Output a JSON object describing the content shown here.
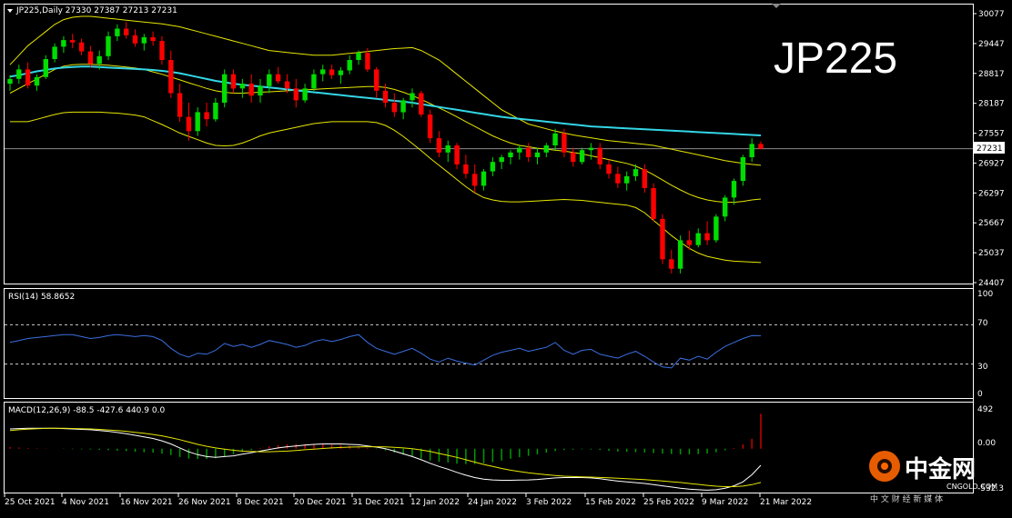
{
  "colors": {
    "background": "#000000",
    "frame": "#ffffff",
    "bull": "#00dd00",
    "bear": "#ff0000",
    "ma200": "#33d6e6",
    "bollinger": "#e6e600",
    "rsi": "#3a6fe0",
    "macd_line": "#ffffff",
    "macd_signal": "#e6e600",
    "hist_pos": "#cc0000",
    "hist_neg": "#009900",
    "watermark": "#ff6600"
  },
  "header": {
    "menu_icon": "triangle-down-icon",
    "text": "JP225,Daily  27330 27387 27213 27231"
  },
  "overlay_title": "JP225",
  "price_axis": {
    "labels": [
      "30077",
      "29447",
      "28817",
      "28187",
      "27557",
      "26927",
      "26297",
      "25667",
      "25037",
      "24407"
    ],
    "values": [
      30077,
      29447,
      28817,
      28187,
      27557,
      26927,
      26297,
      25667,
      25037,
      24407
    ],
    "current": "27231",
    "current_value": 27231
  },
  "rsi": {
    "title": "RSI(14) 58.8652",
    "axis_labels": [
      "100",
      "70",
      "30",
      "0"
    ],
    "levels": [
      70,
      30
    ]
  },
  "macd": {
    "title": "MACD(12,26,9) -88.5 -427.6 440.9 0.0",
    "axis_labels": [
      "492",
      "0.00",
      "-532.3"
    ]
  },
  "date_labels": [
    "25 Oct 2021",
    "4 Nov 2021",
    "16 Nov 2021",
    "26 Nov 2021",
    "8 Dec 2021",
    "20 Dec 2021",
    "31 Dec 2021",
    "12 Jan 2022",
    "24 Jan 2022",
    "3 Feb 2022",
    "15 Feb 2022",
    "25 Feb 2022",
    "9 Mar 2022",
    "21 Mar 2022"
  ],
  "watermark": {
    "logo_icon": "zhongjin-logo-icon",
    "name": "中金网",
    "domain": "CNGOLD.COM",
    "slogan": "中 文 财 经 新 媒 体"
  },
  "chart_data": {
    "type": "candlestick",
    "symbol": "JP225",
    "timeframe": "Daily",
    "ohlc_last": {
      "open": 27330,
      "high": 27387,
      "low": 27213,
      "close": 27231
    },
    "ylim": [
      24407,
      30077
    ],
    "candles": [
      [
        28600,
        28780,
        28450,
        28700
      ],
      [
        28700,
        29000,
        28600,
        28900
      ],
      [
        28900,
        29050,
        28500,
        28560
      ],
      [
        28560,
        28800,
        28450,
        28740
      ],
      [
        28740,
        29200,
        28700,
        29120
      ],
      [
        29120,
        29450,
        29050,
        29380
      ],
      [
        29380,
        29600,
        29250,
        29520
      ],
      [
        29520,
        29650,
        29350,
        29470
      ],
      [
        29470,
        29550,
        29200,
        29280
      ],
      [
        29280,
        29400,
        28950,
        29020
      ],
      [
        29020,
        29300,
        28900,
        29180
      ],
      [
        29180,
        29700,
        29100,
        29600
      ],
      [
        29600,
        29850,
        29500,
        29760
      ],
      [
        29760,
        29900,
        29550,
        29620
      ],
      [
        29620,
        29750,
        29380,
        29450
      ],
      [
        29450,
        29650,
        29300,
        29580
      ],
      [
        29580,
        29700,
        29400,
        29500
      ],
      [
        29500,
        29600,
        29000,
        29100
      ],
      [
        29100,
        29300,
        28300,
        28400
      ],
      [
        28400,
        28600,
        27800,
        27900
      ],
      [
        27900,
        28200,
        27400,
        27600
      ],
      [
        27600,
        28100,
        27500,
        28000
      ],
      [
        28000,
        28200,
        27700,
        27850
      ],
      [
        27850,
        28300,
        27800,
        28200
      ],
      [
        28200,
        28900,
        28100,
        28800
      ],
      [
        28800,
        28900,
        28400,
        28500
      ],
      [
        28500,
        28700,
        28300,
        28600
      ],
      [
        28600,
        28800,
        28200,
        28350
      ],
      [
        28350,
        28700,
        28200,
        28550
      ],
      [
        28550,
        28900,
        28400,
        28800
      ],
      [
        28800,
        28950,
        28600,
        28650
      ],
      [
        28650,
        28800,
        28400,
        28500
      ],
      [
        28500,
        28700,
        28100,
        28250
      ],
      [
        28250,
        28600,
        28200,
        28500
      ],
      [
        28500,
        28900,
        28450,
        28800
      ],
      [
        28800,
        29000,
        28650,
        28900
      ],
      [
        28900,
        29000,
        28700,
        28780
      ],
      [
        28780,
        28950,
        28600,
        28880
      ],
      [
        28880,
        29200,
        28800,
        29100
      ],
      [
        29100,
        29300,
        29000,
        29250
      ],
      [
        29250,
        29350,
        28850,
        28900
      ],
      [
        28900,
        28950,
        28300,
        28450
      ],
      [
        28450,
        28600,
        28100,
        28200
      ],
      [
        28200,
        28400,
        27900,
        28000
      ],
      [
        28000,
        28300,
        27850,
        28250
      ],
      [
        28250,
        28500,
        28100,
        28400
      ],
      [
        28400,
        28450,
        27900,
        27950
      ],
      [
        27950,
        28050,
        27350,
        27450
      ],
      [
        27450,
        27600,
        27050,
        27150
      ],
      [
        27150,
        27400,
        26950,
        27300
      ],
      [
        27300,
        27350,
        26800,
        26900
      ],
      [
        26900,
        27100,
        26600,
        26700
      ],
      [
        26700,
        26900,
        26300,
        26450
      ],
      [
        26450,
        26800,
        26350,
        26750
      ],
      [
        26750,
        27050,
        26650,
        26950
      ],
      [
        26950,
        27100,
        26800,
        27050
      ],
      [
        27050,
        27200,
        26900,
        27150
      ],
      [
        27150,
        27300,
        27000,
        27250
      ],
      [
        27250,
        27350,
        26950,
        27050
      ],
      [
        27050,
        27250,
        26900,
        27150
      ],
      [
        27150,
        27350,
        27050,
        27300
      ],
      [
        27300,
        27650,
        27200,
        27550
      ],
      [
        27550,
        27650,
        27050,
        27150
      ],
      [
        27150,
        27250,
        26850,
        26950
      ],
      [
        26950,
        27250,
        26900,
        27200
      ],
      [
        27200,
        27350,
        27000,
        27250
      ],
      [
        27250,
        27350,
        26800,
        26900
      ],
      [
        26900,
        27000,
        26600,
        26700
      ],
      [
        26700,
        26850,
        26400,
        26500
      ],
      [
        26500,
        26750,
        26350,
        26650
      ],
      [
        26650,
        26900,
        26550,
        26800
      ],
      [
        26800,
        26900,
        26300,
        26400
      ],
      [
        26400,
        26500,
        25700,
        25750
      ],
      [
        25750,
        25850,
        24800,
        24900
      ],
      [
        24900,
        25100,
        24600,
        24700
      ],
      [
        24700,
        25400,
        24600,
        25300
      ],
      [
        25300,
        25500,
        25100,
        25200
      ],
      [
        25200,
        25550,
        25150,
        25450
      ],
      [
        25450,
        25700,
        25200,
        25300
      ],
      [
        25300,
        25850,
        25250,
        25800
      ],
      [
        25800,
        26250,
        25700,
        26200
      ],
      [
        26200,
        26600,
        26050,
        26550
      ],
      [
        26550,
        27100,
        26450,
        27050
      ],
      [
        27050,
        27450,
        26950,
        27330
      ],
      [
        27330,
        27387,
        27213,
        27231
      ]
    ],
    "moving_average_200": [
      28750,
      28780,
      28820,
      28860,
      28890,
      28920,
      28940,
      28950,
      28960,
      28960,
      28950,
      28940,
      28930,
      28920,
      28910,
      28900,
      28890,
      28870,
      28850,
      28820,
      28780,
      28740,
      28700,
      28660,
      28630,
      28600,
      28580,
      28560,
      28540,
      28520,
      28500,
      28480,
      28460,
      28440,
      28420,
      28400,
      28380,
      28360,
      28340,
      28320,
      28300,
      28280,
      28260,
      28240,
      28220,
      28200,
      28170,
      28140,
      28110,
      28080,
      28050,
      28020,
      27990,
      27960,
      27930,
      27900,
      27880,
      27860,
      27840,
      27820,
      27800,
      27780,
      27760,
      27740,
      27720,
      27700,
      27690,
      27680,
      27670,
      27660,
      27650,
      27640,
      27630,
      27620,
      27610,
      27600,
      27590,
      27580,
      27570,
      27560,
      27550,
      27540,
      27530,
      27520,
      27510
    ],
    "bollinger_upper": [
      29000,
      29200,
      29400,
      29550,
      29700,
      29850,
      29950,
      30000,
      30020,
      30020,
      30000,
      29980,
      29960,
      29940,
      29920,
      29900,
      29880,
      29860,
      29830,
      29800,
      29750,
      29700,
      29650,
      29600,
      29550,
      29500,
      29450,
      29400,
      29350,
      29300,
      29280,
      29260,
      29240,
      29220,
      29200,
      29200,
      29200,
      29220,
      29240,
      29260,
      29280,
      29300,
      29320,
      29340,
      29350,
      29360,
      29300,
      29200,
      29100,
      28950,
      28800,
      28650,
      28500,
      28350,
      28200,
      28050,
      27950,
      27850,
      27750,
      27700,
      27650,
      27600,
      27560,
      27520,
      27490,
      27460,
      27430,
      27400,
      27380,
      27360,
      27340,
      27320,
      27300,
      27260,
      27220,
      27180,
      27140,
      27100,
      27060,
      27020,
      26980,
      26950,
      26920,
      26900,
      26880
    ],
    "bollinger_middle": [
      28400,
      28500,
      28600,
      28700,
      28800,
      28900,
      28970,
      29000,
      29010,
      29010,
      29000,
      28990,
      28970,
      28950,
      28930,
      28900,
      28850,
      28800,
      28740,
      28680,
      28620,
      28560,
      28500,
      28450,
      28420,
      28400,
      28400,
      28410,
      28420,
      28430,
      28440,
      28450,
      28460,
      28470,
      28480,
      28490,
      28500,
      28510,
      28520,
      28530,
      28540,
      28540,
      28520,
      28480,
      28420,
      28350,
      28270,
      28180,
      28090,
      28000,
      27900,
      27800,
      27700,
      27600,
      27500,
      27420,
      27350,
      27300,
      27270,
      27240,
      27220,
      27200,
      27180,
      27150,
      27120,
      27080,
      27040,
      27000,
      26960,
      26920,
      26860,
      26780,
      26680,
      26570,
      26460,
      26360,
      26270,
      26200,
      26150,
      26120,
      26100,
      26100,
      26120,
      26150,
      26170
    ],
    "bollinger_lower": [
      27800,
      27800,
      27800,
      27850,
      27900,
      27950,
      27990,
      28000,
      28000,
      28000,
      28000,
      27990,
      27980,
      27960,
      27940,
      27900,
      27820,
      27740,
      27650,
      27560,
      27490,
      27420,
      27350,
      27300,
      27290,
      27300,
      27350,
      27420,
      27500,
      27560,
      27600,
      27640,
      27680,
      27720,
      27760,
      27780,
      27800,
      27800,
      27800,
      27800,
      27800,
      27780,
      27720,
      27620,
      27490,
      27340,
      27190,
      27030,
      26880,
      26730,
      26580,
      26430,
      26300,
      26200,
      26150,
      26120,
      26110,
      26110,
      26120,
      26130,
      26140,
      26150,
      26160,
      26150,
      26140,
      26120,
      26100,
      26080,
      26060,
      26040,
      25990,
      25880,
      25720,
      25560,
      25400,
      25260,
      25130,
      25030,
      24960,
      24920,
      24880,
      24860,
      24850,
      24840,
      24830
    ],
    "rsi_series": [
      52,
      54,
      56,
      57,
      58,
      59,
      60,
      60,
      58,
      56,
      57,
      59,
      60,
      59,
      58,
      59,
      58,
      54,
      46,
      40,
      37,
      41,
      40,
      44,
      51,
      48,
      50,
      47,
      50,
      54,
      52,
      50,
      47,
      49,
      53,
      55,
      53,
      55,
      58,
      60,
      52,
      46,
      43,
      40,
      43,
      46,
      41,
      35,
      32,
      36,
      33,
      31,
      29,
      34,
      39,
      42,
      44,
      46,
      43,
      45,
      47,
      52,
      44,
      40,
      44,
      45,
      40,
      38,
      36,
      40,
      43,
      38,
      32,
      27,
      26,
      36,
      34,
      38,
      35,
      42,
      48,
      52,
      56,
      59,
      58.8652
    ],
    "macd_main": [
      250,
      255,
      258,
      260,
      260,
      258,
      255,
      250,
      245,
      240,
      230,
      220,
      205,
      190,
      170,
      150,
      130,
      100,
      60,
      10,
      -40,
      -75,
      -100,
      -110,
      -100,
      -90,
      -70,
      -50,
      -30,
      -10,
      10,
      25,
      35,
      45,
      55,
      60,
      60,
      60,
      55,
      50,
      35,
      20,
      0,
      -30,
      -65,
      -100,
      -140,
      -185,
      -225,
      -260,
      -300,
      -335,
      -365,
      -385,
      -395,
      -400,
      -400,
      -398,
      -395,
      -390,
      -380,
      -370,
      -365,
      -365,
      -365,
      -370,
      -380,
      -395,
      -410,
      -420,
      -430,
      -440,
      -455,
      -470,
      -485,
      -500,
      -512,
      -520,
      -525,
      -520,
      -500,
      -470,
      -420,
      -330,
      -210
    ],
    "macd_signal": [
      230,
      240,
      248,
      254,
      257,
      258,
      258,
      256,
      253,
      250,
      245,
      238,
      230,
      220,
      208,
      195,
      180,
      163,
      140,
      115,
      85,
      55,
      30,
      10,
      -5,
      -20,
      -30,
      -35,
      -38,
      -38,
      -35,
      -30,
      -22,
      -13,
      -5,
      3,
      10,
      15,
      20,
      23,
      25,
      25,
      23,
      18,
      10,
      0,
      -15,
      -35,
      -60,
      -85,
      -110,
      -140,
      -170,
      -200,
      -225,
      -250,
      -272,
      -290,
      -305,
      -318,
      -330,
      -340,
      -348,
      -353,
      -357,
      -360,
      -364,
      -368,
      -374,
      -380,
      -386,
      -392,
      -400,
      -408,
      -418,
      -428,
      -440,
      -452,
      -464,
      -475,
      -480,
      -480,
      -474,
      -455,
      -428
    ],
    "macd_histogram": [
      20,
      15,
      10,
      6,
      3,
      0,
      -3,
      -6,
      -8,
      -10,
      -15,
      -18,
      -25,
      -30,
      -38,
      -45,
      -50,
      -63,
      -80,
      -105,
      -125,
      -130,
      -130,
      -120,
      -95,
      -70,
      -40,
      -15,
      8,
      28,
      45,
      55,
      57,
      58,
      60,
      57,
      50,
      45,
      35,
      27,
      10,
      -5,
      -23,
      -48,
      -75,
      -100,
      -125,
      -150,
      -165,
      -175,
      -190,
      -195,
      -195,
      -185,
      -170,
      -150,
      -128,
      -108,
      -90,
      -72,
      -50,
      -30,
      -17,
      -12,
      -8,
      -10,
      -16,
      -27,
      -36,
      -40,
      -44,
      -48,
      -55,
      -62,
      -67,
      -72,
      -72,
      -68,
      -61,
      -45,
      -20,
      10,
      54,
      125,
      440.9
    ]
  }
}
